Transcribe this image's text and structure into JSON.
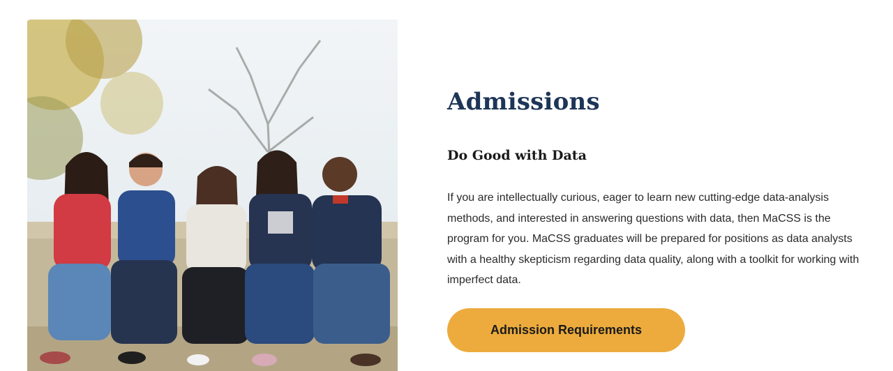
{
  "photo": {
    "alt": "Five students sitting together on a wall outdoors, smiling"
  },
  "admissions": {
    "heading": "Admissions",
    "subheading": "Do Good with Data",
    "body": "If you are intellectually curious, eager to learn new cutting-edge data-analysis methods, and interested in answering questions with data, then MaCSS is the program for you. MaCSS graduates will be prepared for positions as data analysts with a healthy skepticism regarding data quality, along with a toolkit for working with imperfect data.",
    "button_label": "Admission Requirements"
  },
  "colors": {
    "heading": "#1d3557",
    "button": "#ecab3c"
  }
}
